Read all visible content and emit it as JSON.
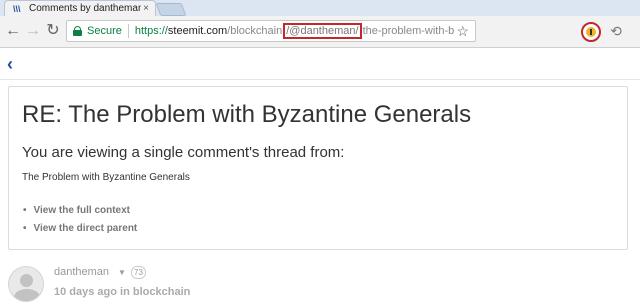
{
  "browser": {
    "tab_title": "Comments by dantheman",
    "tab_favicon": "steemit-icon",
    "tab_close": "×",
    "back": "←",
    "forward": "→",
    "reload": "↻",
    "secure_label": "Secure",
    "url_scheme": "https://",
    "url_host": "steemit.com",
    "url_path_before": "/blockchain",
    "url_highlight": "/@dantheman/",
    "url_path_after": "the-problem-with-b",
    "bookmark_star": "☆",
    "highlight_color": "#c1272d"
  },
  "page": {
    "back_chevron": "‹",
    "title": "RE: The Problem with Byzantine Generals",
    "subtitle": "You are viewing a single comment's thread from:",
    "post_title": "The Problem with Byzantine Generals",
    "links": [
      {
        "label": "View the full context"
      },
      {
        "label": "View the direct parent"
      }
    ]
  },
  "comment": {
    "author": "dantheman",
    "reputation": "73",
    "time": "10 days ago",
    "in_label": "in",
    "category": "blockchain"
  }
}
